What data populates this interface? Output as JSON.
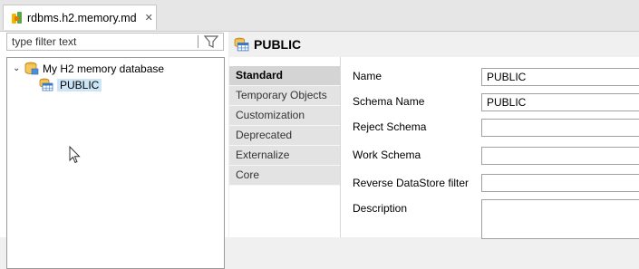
{
  "editor_tab": {
    "title": "rdbms.h2.memory.md",
    "close_glyph": "✕"
  },
  "filter": {
    "placeholder": "type filter text"
  },
  "tree": {
    "root": {
      "label": "My H2 memory database",
      "chevron": "⌄"
    },
    "child": {
      "label": "PUBLIC"
    }
  },
  "header": {
    "title": "PUBLIC"
  },
  "vtabs": [
    "Standard",
    "Temporary Objects",
    "Customization",
    "Deprecated",
    "Externalize",
    "Core"
  ],
  "form": {
    "name_label": "Name",
    "name_value": "PUBLIC",
    "schema_name_label": "Schema Name",
    "schema_name_value": "PUBLIC",
    "reject_schema_label": "Reject Schema",
    "reject_schema_value": "",
    "work_schema_label": "Work Schema",
    "work_schema_value": "",
    "reverse_filter_label": "Reverse DataStore filter",
    "reverse_filter_value": "",
    "description_label": "Description",
    "description_value": ""
  },
  "icons": {
    "file": "model-file-icon",
    "database": "database-icon",
    "schema": "schema-table-icon",
    "filter": "funnel-icon",
    "pointer": "mouse-pointer-icon"
  }
}
